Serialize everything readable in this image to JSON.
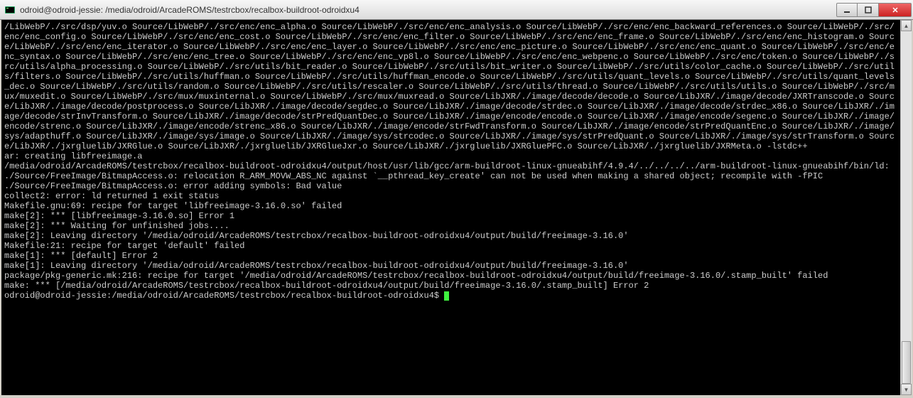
{
  "window": {
    "title": "odroid@odroid-jessie: /media/odroid/ArcadeROMS/testrcbox/recalbox-buildroot-odroidxu4"
  },
  "terminal": {
    "lines": [
      "/LibWebP/./src/dsp/yuv.o Source/LibWebP/./src/enc/enc_alpha.o Source/LibWebP/./src/enc/enc_analysis.o Source/LibWebP/./src/enc/enc_backward_references.o Source/LibWebP/./src/enc/enc_config.o Source/LibWebP/./src/enc/enc_cost.o Source/LibWebP/./src/enc/enc_filter.o Source/LibWebP/./src/enc/enc_frame.o Source/LibWebP/./src/enc/enc_histogram.o Source/LibWebP/./src/enc/enc_iterator.o Source/LibWebP/./src/enc/enc_layer.o Source/LibWebP/./src/enc/enc_picture.o Source/LibWebP/./src/enc/enc_quant.o Source/LibWebP/./src/enc/enc_syntax.o Source/LibWebP/./src/enc/enc_tree.o Source/LibWebP/./src/enc/enc_vp8l.o Source/LibWebP/./src/enc/enc_webpenc.o Source/LibWebP/./src/enc/token.o Source/LibWebP/./src/utils/alpha_processing.o Source/LibWebP/./src/utils/bit_reader.o Source/LibWebP/./src/utils/bit_writer.o Source/LibWebP/./src/utils/color_cache.o Source/LibWebP/./src/utils/filters.o Source/LibWebP/./src/utils/huffman.o Source/LibWebP/./src/utils/huffman_encode.o Source/LibWebP/./src/utils/quant_levels.o Source/LibWebP/./src/utils/quant_levels_dec.o Source/LibWebP/./src/utils/random.o Source/LibWebP/./src/utils/rescaler.o Source/LibWebP/./src/utils/thread.o Source/LibWebP/./src/utils/utils.o Source/LibWebP/./src/mux/muxedit.o Source/LibWebP/./src/mux/muxinternal.o Source/LibWebP/./src/mux/muxread.o Source/LibJXR/./image/decode/decode.o Source/LibJXR/./image/decode/JXRTranscode.o Source/LibJXR/./image/decode/postprocess.o Source/LibJXR/./image/decode/segdec.o Source/LibJXR/./image/decode/strdec.o Source/LibJXR/./image/decode/strdec_x86.o Source/LibJXR/./image/decode/strInvTransform.o Source/LibJXR/./image/decode/strPredQuantDec.o Source/LibJXR/./image/encode/encode.o Source/LibJXR/./image/encode/segenc.o Source/LibJXR/./image/encode/strenc.o Source/LibJXR/./image/encode/strenc_x86.o Source/LibJXR/./image/encode/strFwdTransform.o Source/LibJXR/./image/encode/strPredQuantEnc.o Source/LibJXR/./image/sys/adapthuff.o Source/LibJXR/./image/sys/image.o Source/LibJXR/./image/sys/strcodec.o Source/LibJXR/./image/sys/strPredQuant.o Source/LibJXR/./image/sys/strTransform.o Source/LibJXR/./jxrgluelib/JXRGlue.o Source/LibJXR/./jxrgluelib/JXRGlueJxr.o Source/LibJXR/./jxrgluelib/JXRGluePFC.o Source/LibJXR/./jxrgluelib/JXRMeta.o -lstdc++",
      "ar: creating libfreeimage.a",
      "/media/odroid/ArcadeROMS/testrcbox/recalbox-buildroot-odroidxu4/output/host/usr/lib/gcc/arm-buildroot-linux-gnueabihf/4.9.4/../../../../arm-buildroot-linux-gnueabihf/bin/ld: ./Source/FreeImage/BitmapAccess.o: relocation R_ARM_MOVW_ABS_NC against `__pthread_key_create' can not be used when making a shared object; recompile with -fPIC",
      "./Source/FreeImage/BitmapAccess.o: error adding symbols: Bad value",
      "collect2: error: ld returned 1 exit status",
      "Makefile.gnu:69: recipe for target 'libfreeimage-3.16.0.so' failed",
      "make[2]: *** [libfreeimage-3.16.0.so] Error 1",
      "make[2]: *** Waiting for unfinished jobs....",
      "make[2]: Leaving directory '/media/odroid/ArcadeROMS/testrcbox/recalbox-buildroot-odroidxu4/output/build/freeimage-3.16.0'",
      "Makefile:21: recipe for target 'default' failed",
      "make[1]: *** [default] Error 2",
      "make[1]: Leaving directory '/media/odroid/ArcadeROMS/testrcbox/recalbox-buildroot-odroidxu4/output/build/freeimage-3.16.0'",
      "package/pkg-generic.mk:216: recipe for target '/media/odroid/ArcadeROMS/testrcbox/recalbox-buildroot-odroidxu4/output/build/freeimage-3.16.0/.stamp_built' failed",
      "make: *** [/media/odroid/ArcadeROMS/testrcbox/recalbox-buildroot-odroidxu4/output/build/freeimage-3.16.0/.stamp_built] Error 2"
    ],
    "prompt": "odroid@odroid-jessie:/media/odroid/ArcadeROMS/testrcbox/recalbox-buildroot-odroidxu4$ "
  }
}
